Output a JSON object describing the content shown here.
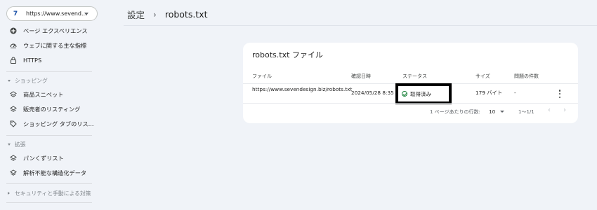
{
  "property": {
    "url": "https://www.sevend...",
    "logo": "7"
  },
  "sidebar": {
    "experience_items": [
      {
        "label": "ページ エクスペリエンス",
        "icon": "plus-circle-icon"
      },
      {
        "label": "ウェブに関する主な指標",
        "icon": "speedometer-icon"
      },
      {
        "label": "HTTPS",
        "icon": "lock-icon"
      }
    ],
    "shopping": {
      "title": "ショッピング",
      "items": [
        {
          "label": "商品スニペット",
          "icon": "layers-icon"
        },
        {
          "label": "販売者のリスティング",
          "icon": "layers-icon"
        },
        {
          "label": "ショッピング タブのリス...",
          "icon": "tag-icon"
        }
      ]
    },
    "enhancements": {
      "title": "拡張",
      "items": [
        {
          "label": "パンくずリスト",
          "icon": "layers-icon"
        },
        {
          "label": "解析不能な構造化データ",
          "icon": "layers-icon"
        }
      ]
    },
    "security": {
      "title": "セキュリティと手動による対策"
    }
  },
  "header": {
    "breadcrumb_parent": "設定",
    "breadcrumb_separator": "›",
    "breadcrumb_current": "robots.txt"
  },
  "card": {
    "title": "robots.txt ファイル",
    "columns": {
      "file": "ファイル",
      "checked": "確認日時",
      "status": "ステータス",
      "size": "サイズ",
      "issues": "問題の件数"
    },
    "row": {
      "file": "https://www.sevendesign.biz/robots.txt",
      "checked": "2024/05/28 8:35",
      "status": "取得済み",
      "size": "179 バイト",
      "issues": "-"
    },
    "pager": {
      "rows_label": "1 ページあたりの行数:",
      "rows_value": "10",
      "range": "1～1/1",
      "prev": "‹",
      "next": "›"
    }
  },
  "colors": {
    "status_ok": "#188038",
    "highlight_border": "#000000",
    "background": "#f0f3f8"
  }
}
